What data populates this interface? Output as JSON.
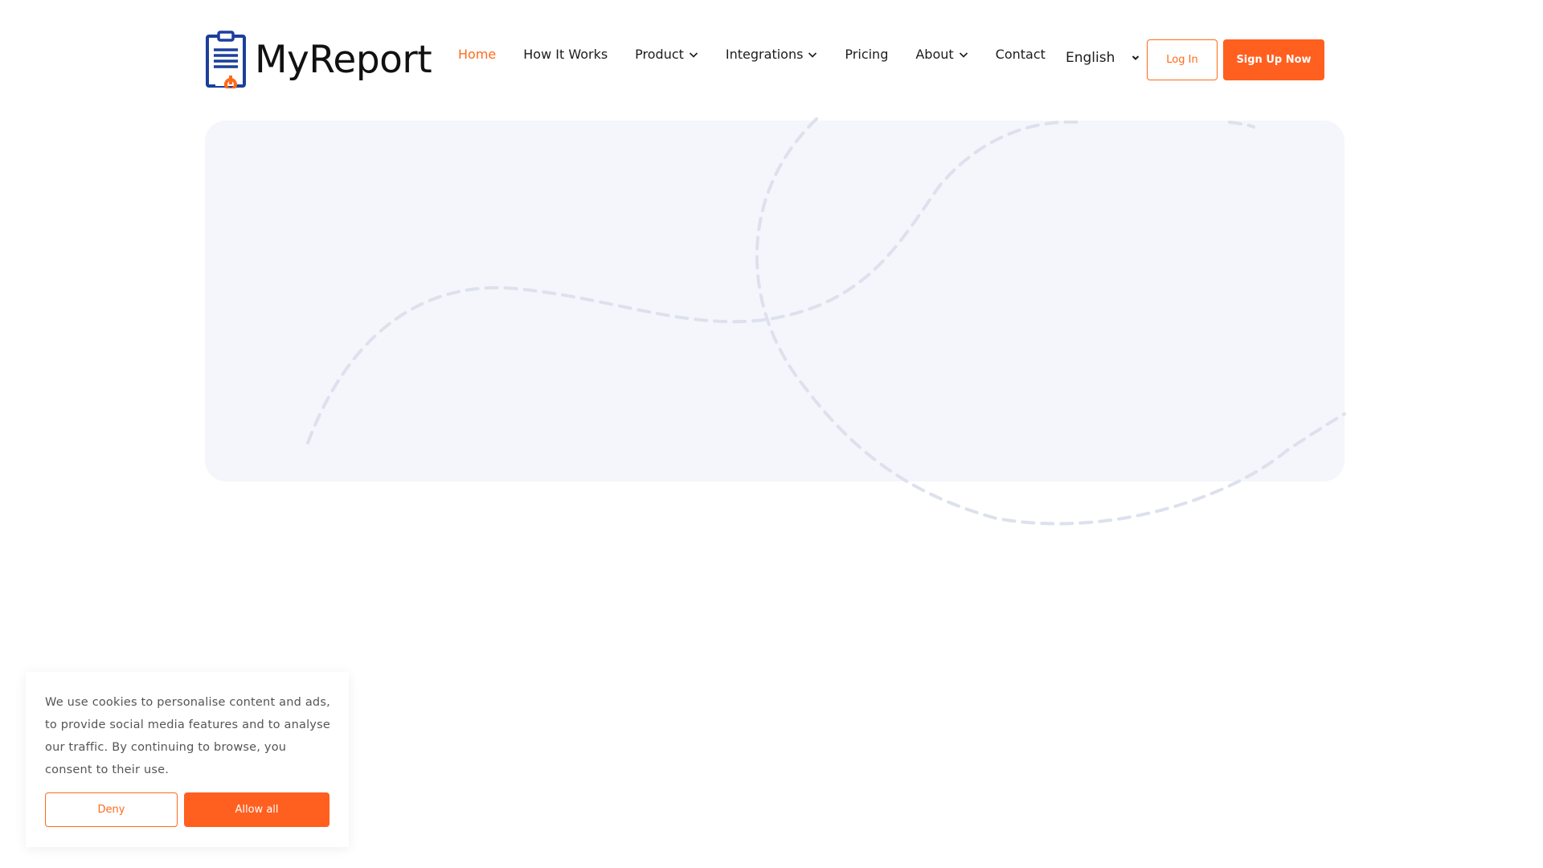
{
  "brand": {
    "name": "MyReport",
    "accent": "#ff6a1a",
    "logo_blue": "#1b3f9c"
  },
  "nav": {
    "items": [
      {
        "label": "Home",
        "active": true,
        "dropdown": false
      },
      {
        "label": "How It Works",
        "active": false,
        "dropdown": false
      },
      {
        "label": "Product",
        "active": false,
        "dropdown": true
      },
      {
        "label": "Integrations",
        "active": false,
        "dropdown": true
      },
      {
        "label": "Pricing",
        "active": false,
        "dropdown": false
      },
      {
        "label": "About",
        "active": false,
        "dropdown": true
      },
      {
        "label": "Contact",
        "active": false,
        "dropdown": false
      }
    ]
  },
  "language": {
    "selected": "English"
  },
  "auth": {
    "login_label": "Log In",
    "signup_label": "Sign Up Now"
  },
  "cookie": {
    "text": "We use cookies to personalise content and ads, to provide social media features and to analyse our traffic. By continuing to browse, you consent to their use.",
    "deny_label": "Deny",
    "allow_label": "Allow all"
  }
}
